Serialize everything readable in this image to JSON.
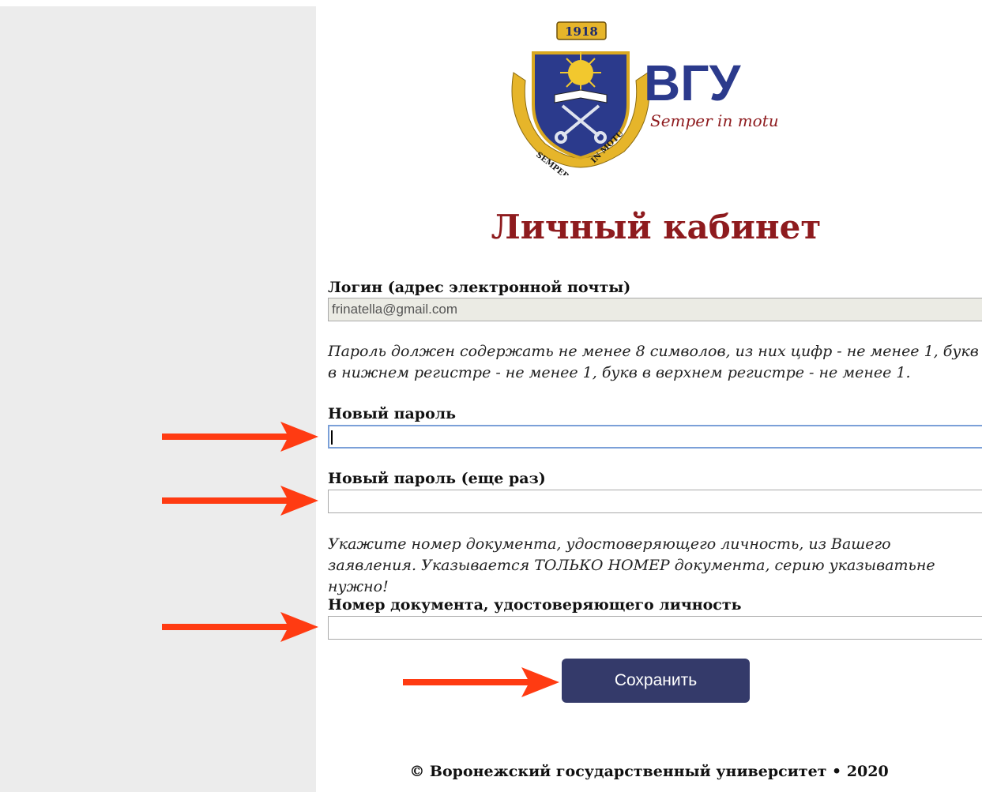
{
  "logo": {
    "year": "1918",
    "abbr": "ВГУ",
    "motto": "Semper in motu",
    "ribbon_left": "SEMPER",
    "ribbon_right": "IN MOTU"
  },
  "page_title": "Личный кабинет",
  "login": {
    "label": "Логин (адрес электронной почты)",
    "value": "frinatella@gmail.com"
  },
  "password_note": "Пароль должен содержать не менее 8 символов, из них цифр - не менее 1, букв в нижнем регистре - не менее 1, букв в верхнем регистре - не менее 1.",
  "new_password": {
    "label": "Новый пароль",
    "value": ""
  },
  "new_password_repeat": {
    "label": "Новый пароль (еще раз)",
    "value": ""
  },
  "document_note": "Укажите номер документа, удостоверяющего личность, из Вашего заявления. Указывается ТОЛЬКО НОМЕР документа, серию указыватьне нужно!",
  "document_number": {
    "label": "Номер документа, удостоверяющего личность",
    "value": ""
  },
  "save_label": "Сохранить",
  "footer": "© Воронежский государственный университет • 2020",
  "colors": {
    "title": "#8e1b1e",
    "button": "#343a6a",
    "arrow": "#ff3b12",
    "sidebar": "#ececec",
    "logo_blue": "#2b3a8c"
  }
}
